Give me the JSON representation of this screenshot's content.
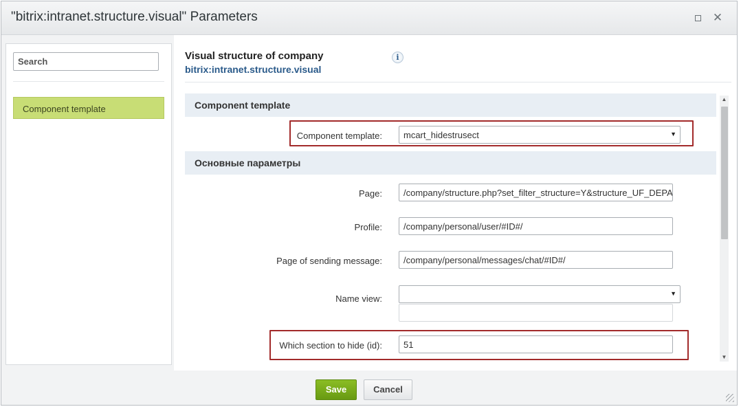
{
  "window": {
    "title": "\"bitrix:intranet.structure.visual\" Parameters",
    "maximize_icon": "maximize-icon",
    "close_icon": "close-icon"
  },
  "sidebar": {
    "search_placeholder": "Search",
    "items": [
      {
        "label": "Component template",
        "active": true
      }
    ]
  },
  "main": {
    "title": "Visual structure of company",
    "subtitle": "bitrix:intranet.structure.visual",
    "info_icon": "info-icon",
    "sections": [
      {
        "title": "Component template",
        "fields": [
          {
            "label": "Component template:",
            "value": "mcart_hidestrusect",
            "type": "select"
          }
        ]
      },
      {
        "title": "Основные параметры",
        "fields": [
          {
            "label": "Page:",
            "value": "/company/structure.php?set_filter_structure=Y&structure_UF_DEPARTMENT=#ID#",
            "type": "text"
          },
          {
            "label": "Profile:",
            "value": "/company/personal/user/#ID#/",
            "type": "text"
          },
          {
            "label": "Page of sending message:",
            "value": "/company/personal/messages/chat/#ID#/",
            "type": "text"
          },
          {
            "label": "Name view:",
            "value": "",
            "type": "select",
            "extra_value": ""
          },
          {
            "label": "Which section to hide  (id):",
            "value": "51",
            "type": "text"
          }
        ]
      }
    ]
  },
  "footer": {
    "save_label": "Save",
    "cancel_label": "Cancel"
  },
  "colors": {
    "accent_green": "#7aab1b",
    "sidebar_active": "#c8dd75",
    "link_blue": "#2a5a8a",
    "highlight_red": "#a22a2a"
  }
}
